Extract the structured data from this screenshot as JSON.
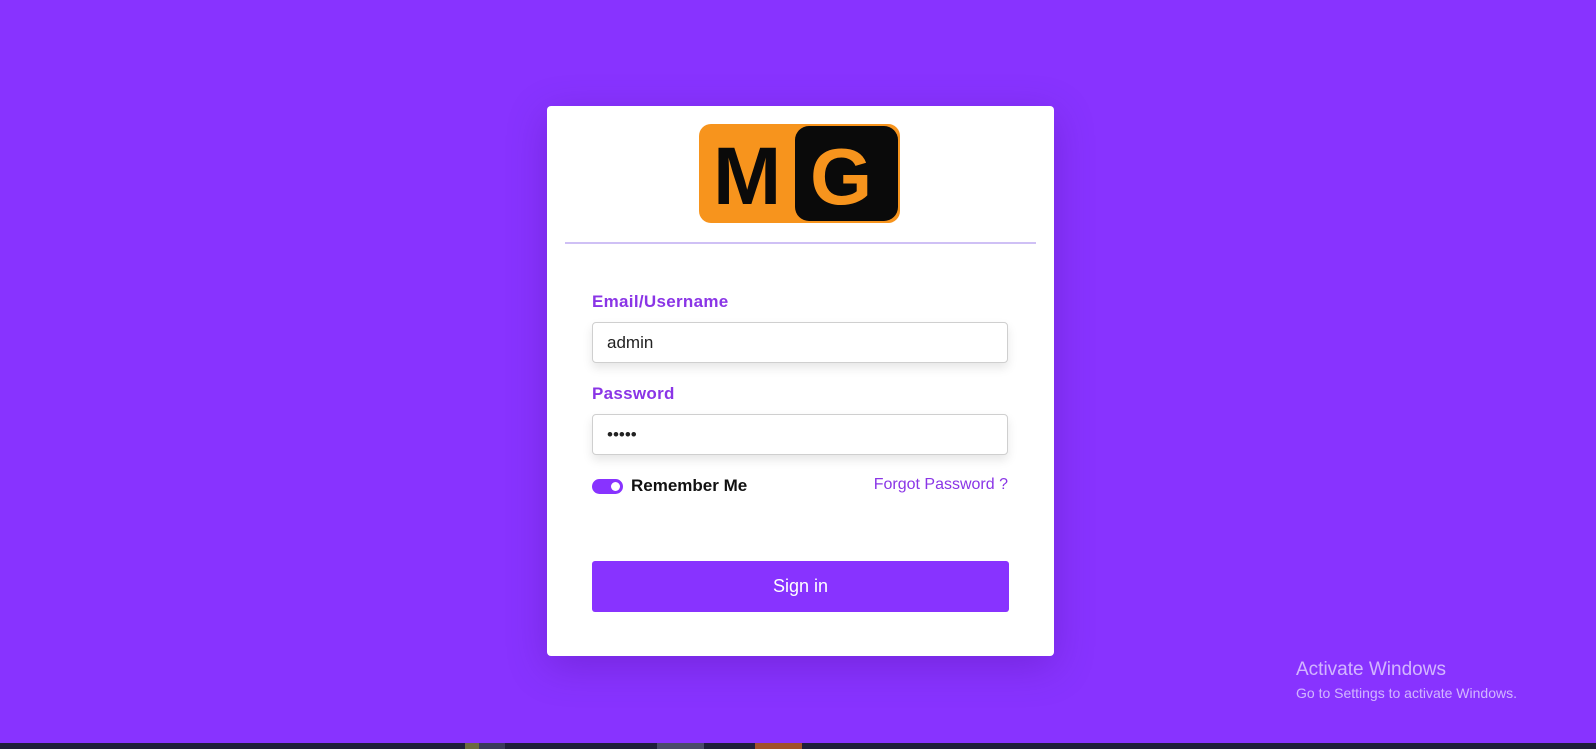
{
  "colors": {
    "background": "#8833ff",
    "accent": "#8a35e6",
    "card": "#ffffff",
    "logo_orange": "#f7941d",
    "logo_dark": "#0a0a0a"
  },
  "logo": {
    "text": "MG",
    "letter_m": "M",
    "letter_g": "G"
  },
  "form": {
    "email_label": "Email/Username",
    "email_value": "admin",
    "password_label": "Password",
    "password_value": "•••••",
    "remember_label": "Remember Me",
    "remember_checked": true,
    "forgot_label": "Forgot Password ?",
    "signin_label": "Sign in"
  },
  "watermark": {
    "title": "Activate Windows",
    "subtitle": "Go to Settings to activate Windows."
  }
}
